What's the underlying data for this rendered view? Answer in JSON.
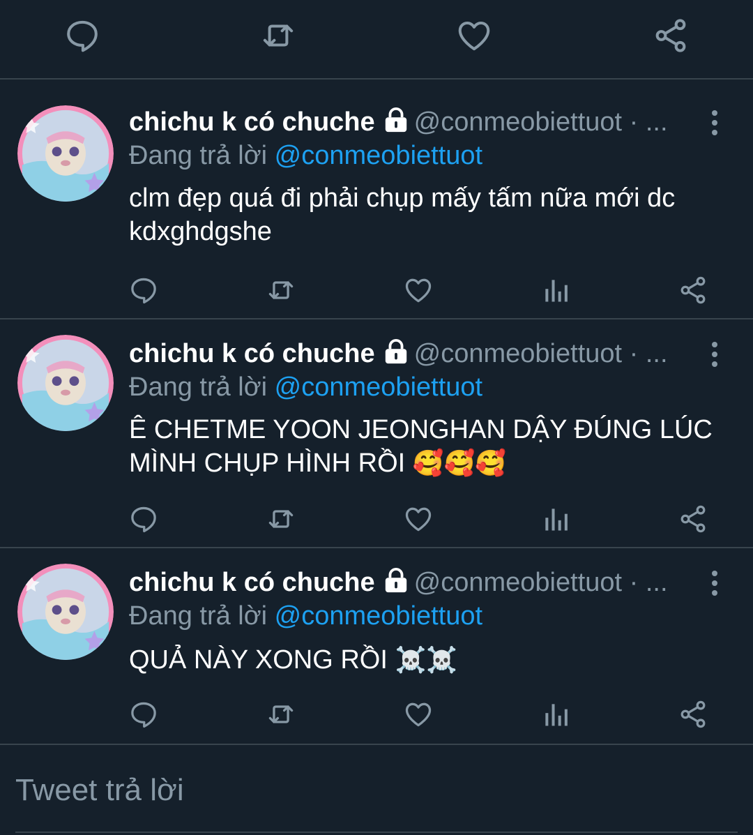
{
  "colors": {
    "background": "#15202b",
    "divider": "#38444d",
    "muted": "#8899a6",
    "link": "#1da1f2",
    "text": "#ffffff"
  },
  "top_actions": [
    "reply-icon",
    "retweet-icon",
    "like-icon",
    "share-icon"
  ],
  "tweets": [
    {
      "name": "chichu k có chuche",
      "handle": "@conmeobiettuot · ...",
      "reply_prefix": "Đang trả lời ",
      "reply_mention": "@conmeobiettuot",
      "text": "clm đẹp quá đi phải chụp mấy tấm nữa mới dc kdxghdgshe",
      "emoji": ""
    },
    {
      "name": "chichu k có chuche",
      "handle": "@conmeobiettuot · ...",
      "reply_prefix": "Đang trả lời ",
      "reply_mention": "@conmeobiettuot",
      "text": "Ê CHETME YOON JEONGHAN DẬY ĐÚNG LÚC MÌNH CHỤP HÌNH RỒI ",
      "emoji": "🥰🥰🥰"
    },
    {
      "name": "chichu k có chuche",
      "handle": "@conmeobiettuot · ...",
      "reply_prefix": "Đang trả lời ",
      "reply_mention": "@conmeobiettuot",
      "text": "QUẢ NÀY XONG RỒI ",
      "emoji": "☠️☠️"
    }
  ],
  "composer": {
    "placeholder": "Tweet trả lời"
  }
}
